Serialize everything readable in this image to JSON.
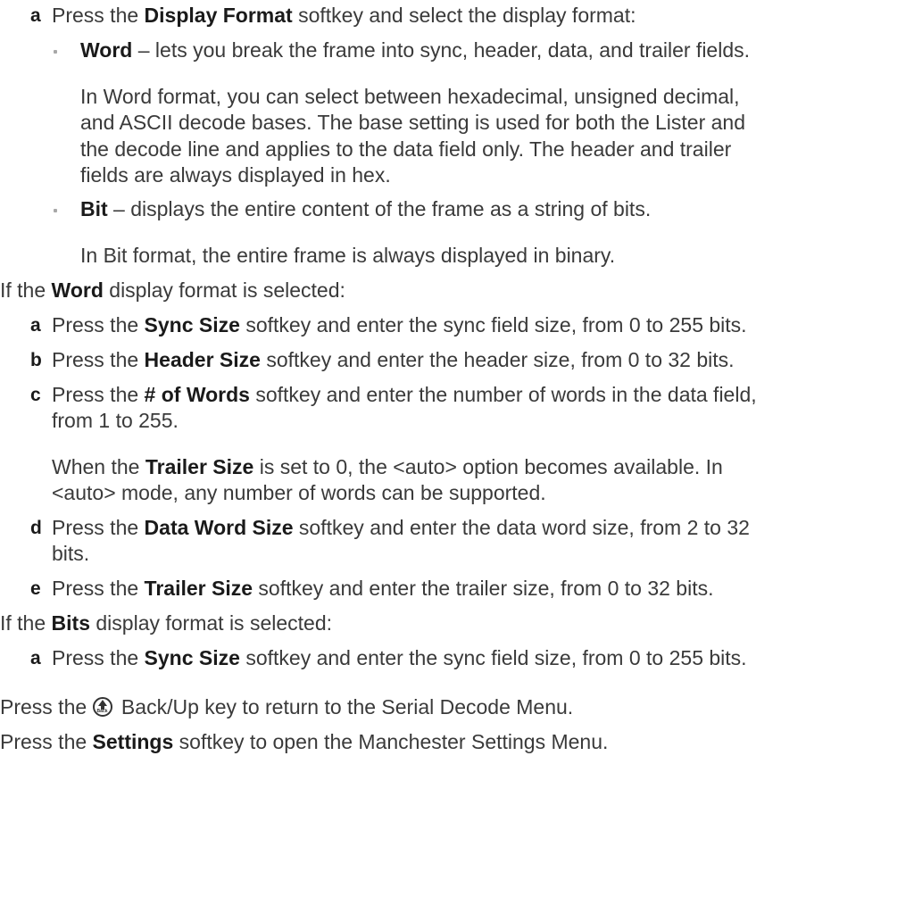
{
  "display_format_step": {
    "letter": "a",
    "pre": "Press the ",
    "key": "Display Format",
    "post": " softkey and select the display format:"
  },
  "word_option": {
    "name": "Word",
    "desc": " – lets you break the frame into sync, header, data, and trailer fields.",
    "note_lines": [
      "In Word format, you can select between hexadecimal, unsigned decimal,",
      "and ASCII decode bases. The base setting is used for both the Lister and",
      "the decode line and applies to the data field only. The header and trailer",
      "fields are always displayed in hex."
    ]
  },
  "bit_option": {
    "name": "Bit",
    "desc": " – displays the entire content of the frame as a string of bits.",
    "note": "In Bit format, the entire frame is always displayed in binary."
  },
  "word_intro": {
    "pre": "If the ",
    "key": "Word",
    "post": " display format is selected:"
  },
  "word_steps": [
    {
      "letter": "a",
      "pre": "Press the ",
      "key": "Sync Size",
      "post": " softkey and enter the sync field size, from 0 to 255 bits."
    },
    {
      "letter": "b",
      "pre": "Press the ",
      "key": "Header Size",
      "post": " softkey and enter the header size, from 0 to 32 bits."
    },
    {
      "letter": "c",
      "pre": "Press the ",
      "key": "# of Words",
      "post": " softkey and enter the number of words in the data field,",
      "cont": "from 1 to 255."
    },
    {
      "letter": "d",
      "pre": "Press the ",
      "key": "Data Word Size",
      "post": " softkey and enter the data word size, from 2 to 32",
      "cont": "bits."
    },
    {
      "letter": "e",
      "pre": "Press the ",
      "key": "Trailer Size",
      "post": " softkey and enter the trailer size, from 0 to 32 bits."
    }
  ],
  "trailer_note": {
    "pre": "When the ",
    "key": "Trailer Size",
    "post": " is set to 0, the <auto> option becomes available. In",
    "line2": "<auto> mode, any number of words can be supported."
  },
  "bits_intro": {
    "pre": "If the ",
    "key": "Bits",
    "post": " display format is selected:"
  },
  "bits_step": {
    "letter": "a",
    "pre": "Press the ",
    "key": "Sync Size",
    "post": " softkey and enter the sync field size, from 0 to 255 bits."
  },
  "back_step": {
    "pre": "Press the ",
    "icon": "back-up-key-icon",
    "icon_text": "Back",
    "post": " Back/Up key to return to the Serial Decode Menu."
  },
  "settings_step": {
    "pre": "Press the ",
    "key": "Settings",
    "post": " softkey to open the Manchester Settings Menu."
  }
}
